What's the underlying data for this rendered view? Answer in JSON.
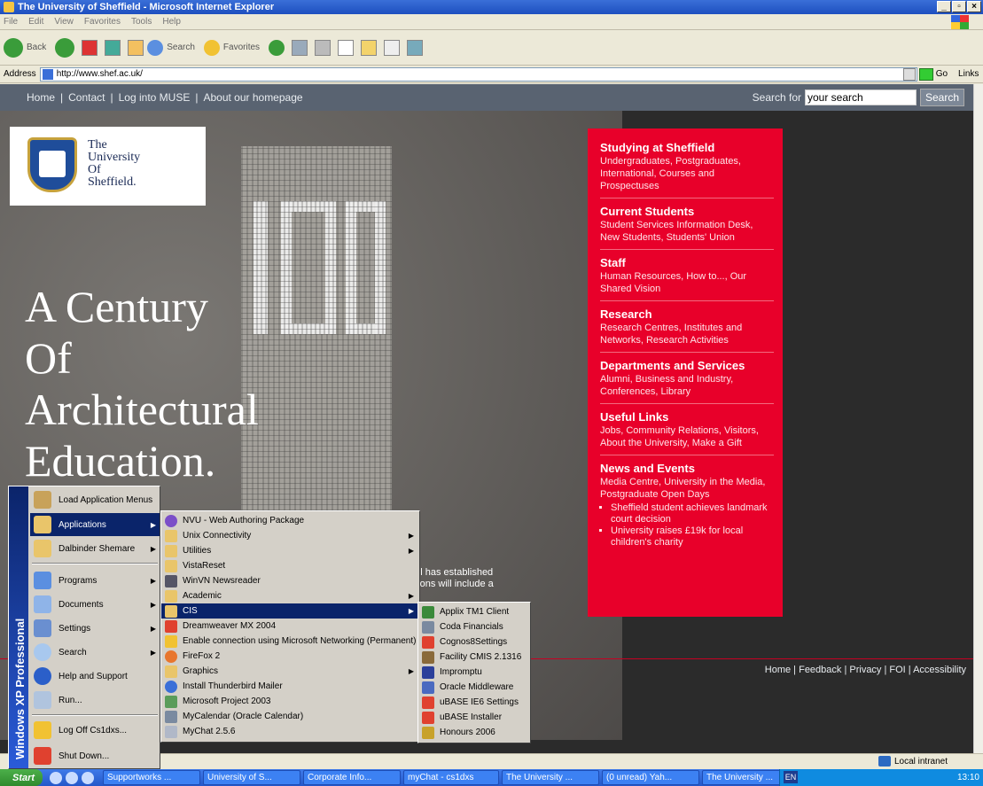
{
  "window": {
    "title": "The University of Sheffield - Microsoft Internet Explorer",
    "menus": [
      "File",
      "Edit",
      "View",
      "Favorites",
      "Tools",
      "Help"
    ],
    "toolbar": {
      "back": "Back",
      "search": "Search",
      "favorites": "Favorites"
    },
    "address_label": "Address",
    "address_url": "http://www.shef.ac.uk/",
    "go_label": "Go",
    "links_label": "Links"
  },
  "page": {
    "topnav": [
      "Home",
      "Contact",
      "Log into MUSE",
      "About our homepage"
    ],
    "search_label": "Search for",
    "search_value": "your search",
    "search_button": "Search",
    "logo_lines": [
      "The",
      "University",
      "Of",
      "Sheffield."
    ],
    "headline": [
      "A Century",
      "Of",
      "Architectural",
      "Education."
    ],
    "snippet": [
      "ool has established",
      "ations will include a"
    ],
    "sections": [
      {
        "title": "Studying at Sheffield",
        "text": "Undergraduates, Postgraduates, International, Courses and Prospectuses"
      },
      {
        "title": "Current Students",
        "text": "Student Services Information Desk, New Students, Students' Union"
      },
      {
        "title": "Staff",
        "text": "Human Resources, How to..., Our Shared Vision"
      },
      {
        "title": "Research",
        "text": "Research Centres, Institutes and Networks, Research Activities"
      },
      {
        "title": "Departments and Services",
        "text": "Alumni, Business and Industry, Conferences, Library"
      },
      {
        "title": "Useful Links",
        "text": "Jobs, Community Relations, Visitors, About the University, Make a Gift"
      },
      {
        "title": "News and Events",
        "text": "Media Centre, University in the Media, Postgraduate Open Days"
      }
    ],
    "news": [
      "Sheffield student achieves landmark court decision",
      "University raises £19k for local children's charity"
    ],
    "footer": "Home | Feedback | Privacy | FOI | Accessibility"
  },
  "status": {
    "zone": "Local intranet"
  },
  "startmenu": {
    "band": "Windows XP Professional",
    "items": [
      "Load Application Menus",
      "Applications",
      "Dalbinder Shemare",
      "Programs",
      "Documents",
      "Settings",
      "Search",
      "Help and Support",
      "Run...",
      "Log Off Cs1dxs...",
      "Shut Down..."
    ]
  },
  "appmenu": [
    "NVU - Web Authoring Package",
    "Unix Connectivity",
    "Utilities",
    "VistaReset",
    "WinVN Newsreader",
    "Academic",
    "CIS",
    "Dreamweaver MX 2004",
    "Enable connection using Microsoft Networking (Permanent)",
    "FireFox 2",
    "Graphics",
    "Install Thunderbird Mailer",
    "Microsoft Project 2003",
    "MyCalendar (Oracle Calendar)",
    "MyChat 2.5.6"
  ],
  "cismenu": [
    "Applix TM1 Client",
    "Coda Financials",
    "Cognos8Settings",
    "Facility CMIS 2.1316",
    "Impromptu",
    "Oracle Middleware",
    "uBASE IE6 Settings",
    "uBASE Installer",
    "Honours 2006"
  ],
  "taskbar": {
    "start": "Start",
    "tasks": [
      "Supportworks ...",
      "University of S...",
      "Corporate Info...",
      "myChat - cs1dxs",
      "The University ...",
      "(0 unread) Yah...",
      "The University ..."
    ],
    "lang": "EN",
    "clock": "13:10"
  }
}
